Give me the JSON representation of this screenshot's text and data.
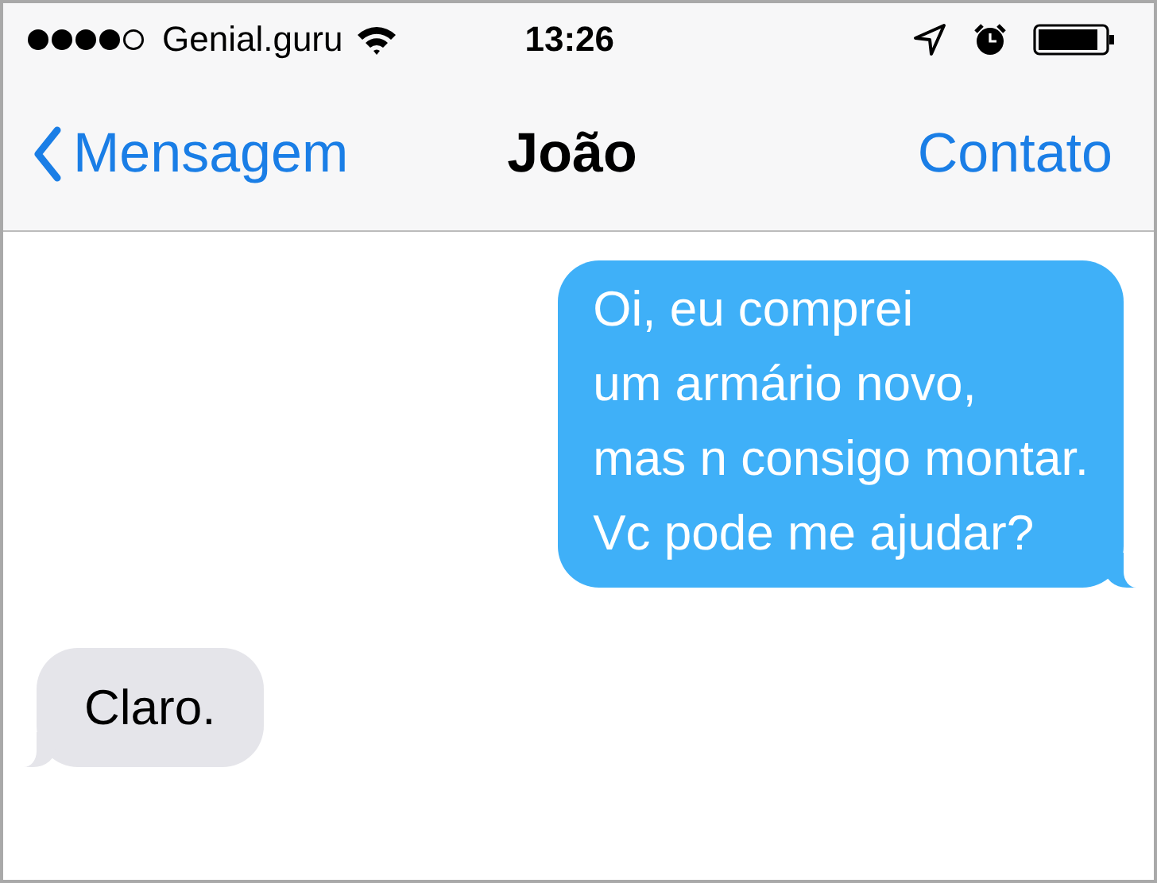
{
  "status_bar": {
    "carrier": "Genial.guru",
    "time": "13:26"
  },
  "nav_bar": {
    "back": "Mensagem",
    "title": "João",
    "action": "Contato"
  },
  "messages": [
    {
      "kind": "sent",
      "text": "Oi, eu comprei\num armário novo,\nmas n consigo montar.\nVc pode me ajudar?"
    },
    {
      "kind": "received",
      "text": "Claro."
    }
  ]
}
